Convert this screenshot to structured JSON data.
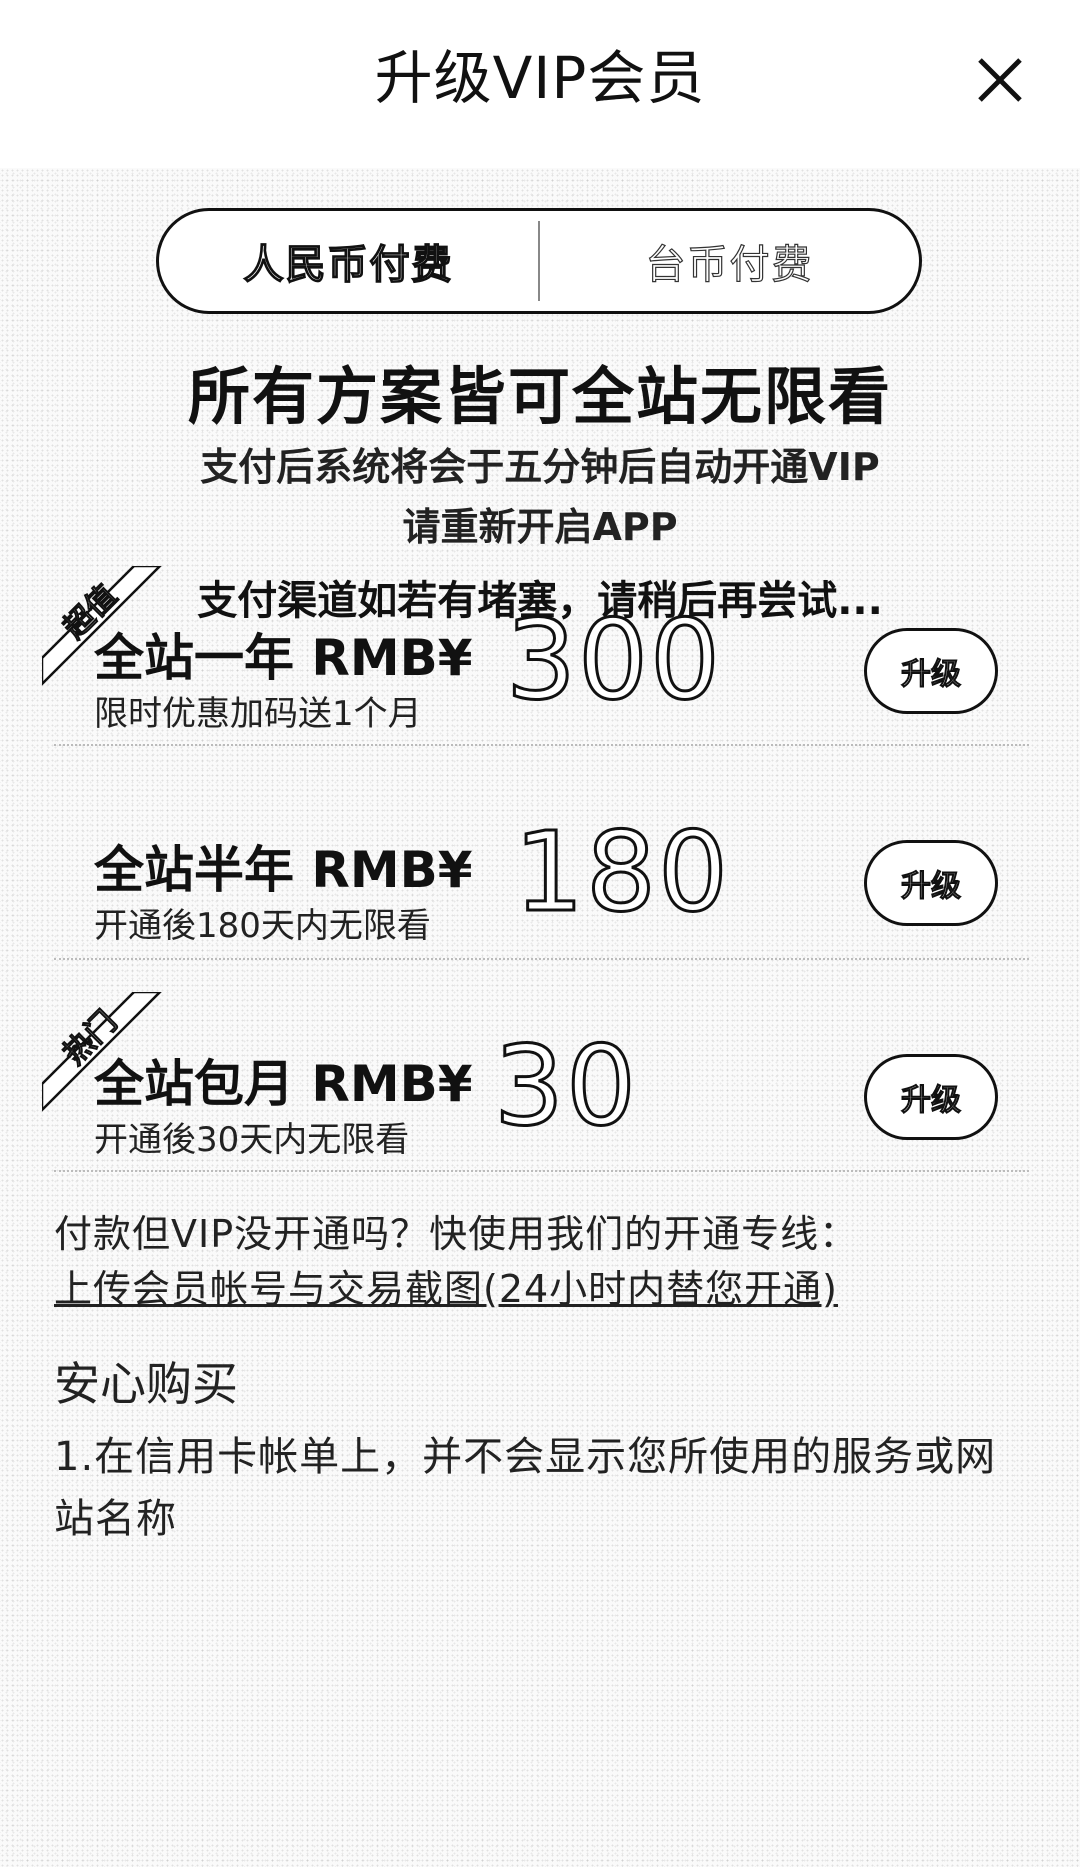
{
  "header": {
    "title": "升级VIP会员",
    "close_icon": "close-icon"
  },
  "payment_toggle": {
    "options": [
      "人民币付费",
      "台币付费"
    ],
    "selected": "人民币付费"
  },
  "headline": "所有方案皆可全站无限看",
  "notice": {
    "line1": "支付后系统将会于五分钟后自动开通VIP",
    "line2": "请重新开启APP",
    "line3": "支付渠道如若有堵塞，请稍后再尝试..."
  },
  "plans": [
    {
      "ribbon": "超值",
      "title": "全站一年 RMB¥",
      "price": "300",
      "desc": "限时优惠加码送1个月",
      "button": "升级"
    },
    {
      "ribbon": "",
      "title": "全站半年 RMB¥",
      "price": "180",
      "desc": "开通後180天内无限看",
      "button": "升级"
    },
    {
      "ribbon": "热门",
      "title": "全站包月 RMB¥",
      "price": "30",
      "desc": "开通後30天内无限看",
      "button": "升级"
    }
  ],
  "help": {
    "text": "付款但VIP没开通吗？快使用我们的开通专线：",
    "link": "上传会员帐号与交易截图(24小时内替您开通)"
  },
  "safe": {
    "title": "安心购买",
    "items": [
      "1.在信用卡帐单上，并不会显示您所使用的服务或网站名称"
    ]
  },
  "colors": {
    "text": "#111111",
    "background": "#fafafa",
    "separator": "#bbbbbb"
  }
}
